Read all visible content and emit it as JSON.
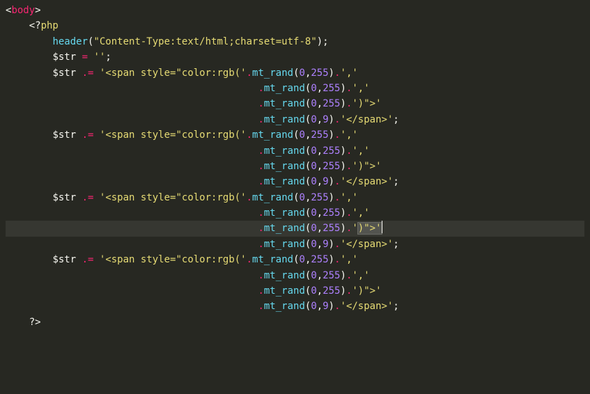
{
  "lines": [
    {
      "segments": [
        {
          "t": "<",
          "c": "tag-angle"
        },
        {
          "t": "body",
          "c": "tag-name"
        },
        {
          "t": ">",
          "c": "tag-angle"
        }
      ]
    },
    {
      "indent": "    ",
      "segments": [
        {
          "t": "<?",
          "c": "punct"
        },
        {
          "t": "php",
          "c": "php-open"
        }
      ]
    },
    {
      "indent": "        ",
      "segments": [
        {
          "t": "header",
          "c": "func"
        },
        {
          "t": "(",
          "c": "punct"
        },
        {
          "t": "\"Content-Type:text/html;charset=utf-8\"",
          "c": "string"
        },
        {
          "t": ");",
          "c": "punct"
        }
      ]
    },
    {
      "indent": "        ",
      "segments": [
        {
          "t": "$str",
          "c": "var"
        },
        {
          "t": " ",
          "c": "punct"
        },
        {
          "t": "=",
          "c": "op"
        },
        {
          "t": " ",
          "c": "punct"
        },
        {
          "t": "''",
          "c": "string"
        },
        {
          "t": ";",
          "c": "punct"
        }
      ]
    },
    {
      "indent": "        ",
      "segments": [
        {
          "t": "$str",
          "c": "var"
        },
        {
          "t": " ",
          "c": "punct"
        },
        {
          "t": ".=",
          "c": "op"
        },
        {
          "t": " ",
          "c": "punct"
        },
        {
          "t": "'<span style=\"color:rgb('",
          "c": "string"
        },
        {
          "t": ".",
          "c": "op"
        },
        {
          "t": "mt_rand",
          "c": "func"
        },
        {
          "t": "(",
          "c": "punct"
        },
        {
          "t": "0",
          "c": "num"
        },
        {
          "t": ",",
          "c": "punct"
        },
        {
          "t": "255",
          "c": "num"
        },
        {
          "t": ")",
          "c": "punct"
        },
        {
          "t": ".",
          "c": "op"
        },
        {
          "t": "','",
          "c": "string"
        }
      ]
    },
    {
      "indent": "                                           ",
      "segments": [
        {
          "t": ".",
          "c": "op"
        },
        {
          "t": "mt_rand",
          "c": "func"
        },
        {
          "t": "(",
          "c": "punct"
        },
        {
          "t": "0",
          "c": "num"
        },
        {
          "t": ",",
          "c": "punct"
        },
        {
          "t": "255",
          "c": "num"
        },
        {
          "t": ")",
          "c": "punct"
        },
        {
          "t": ".",
          "c": "op"
        },
        {
          "t": "','",
          "c": "string"
        }
      ]
    },
    {
      "indent": "                                           ",
      "segments": [
        {
          "t": ".",
          "c": "op"
        },
        {
          "t": "mt_rand",
          "c": "func"
        },
        {
          "t": "(",
          "c": "punct"
        },
        {
          "t": "0",
          "c": "num"
        },
        {
          "t": ",",
          "c": "punct"
        },
        {
          "t": "255",
          "c": "num"
        },
        {
          "t": ")",
          "c": "punct"
        },
        {
          "t": ".",
          "c": "op"
        },
        {
          "t": "')\">'",
          "c": "string"
        }
      ]
    },
    {
      "indent": "                                           ",
      "segments": [
        {
          "t": ".",
          "c": "op"
        },
        {
          "t": "mt_rand",
          "c": "func"
        },
        {
          "t": "(",
          "c": "punct"
        },
        {
          "t": "0",
          "c": "num"
        },
        {
          "t": ",",
          "c": "punct"
        },
        {
          "t": "9",
          "c": "num"
        },
        {
          "t": ")",
          "c": "punct"
        },
        {
          "t": ".",
          "c": "op"
        },
        {
          "t": "'</span>'",
          "c": "string"
        },
        {
          "t": ";",
          "c": "punct"
        }
      ]
    },
    {
      "indent": "        ",
      "segments": [
        {
          "t": "$str",
          "c": "var"
        },
        {
          "t": " ",
          "c": "punct"
        },
        {
          "t": ".=",
          "c": "op"
        },
        {
          "t": " ",
          "c": "punct"
        },
        {
          "t": "'<span style=\"color:rgb('",
          "c": "string"
        },
        {
          "t": ".",
          "c": "op"
        },
        {
          "t": "mt_rand",
          "c": "func"
        },
        {
          "t": "(",
          "c": "punct"
        },
        {
          "t": "0",
          "c": "num"
        },
        {
          "t": ",",
          "c": "punct"
        },
        {
          "t": "255",
          "c": "num"
        },
        {
          "t": ")",
          "c": "punct"
        },
        {
          "t": ".",
          "c": "op"
        },
        {
          "t": "','",
          "c": "string"
        }
      ]
    },
    {
      "indent": "                                           ",
      "segments": [
        {
          "t": ".",
          "c": "op"
        },
        {
          "t": "mt_rand",
          "c": "func"
        },
        {
          "t": "(",
          "c": "punct"
        },
        {
          "t": "0",
          "c": "num"
        },
        {
          "t": ",",
          "c": "punct"
        },
        {
          "t": "255",
          "c": "num"
        },
        {
          "t": ")",
          "c": "punct"
        },
        {
          "t": ".",
          "c": "op"
        },
        {
          "t": "','",
          "c": "string"
        }
      ]
    },
    {
      "indent": "                                           ",
      "segments": [
        {
          "t": ".",
          "c": "op"
        },
        {
          "t": "mt_rand",
          "c": "func"
        },
        {
          "t": "(",
          "c": "punct"
        },
        {
          "t": "0",
          "c": "num"
        },
        {
          "t": ",",
          "c": "punct"
        },
        {
          "t": "255",
          "c": "num"
        },
        {
          "t": ")",
          "c": "punct"
        },
        {
          "t": ".",
          "c": "op"
        },
        {
          "t": "')\">'",
          "c": "string"
        }
      ]
    },
    {
      "indent": "                                           ",
      "segments": [
        {
          "t": ".",
          "c": "op"
        },
        {
          "t": "mt_rand",
          "c": "func"
        },
        {
          "t": "(",
          "c": "punct"
        },
        {
          "t": "0",
          "c": "num"
        },
        {
          "t": ",",
          "c": "punct"
        },
        {
          "t": "9",
          "c": "num"
        },
        {
          "t": ")",
          "c": "punct"
        },
        {
          "t": ".",
          "c": "op"
        },
        {
          "t": "'</span>'",
          "c": "string"
        },
        {
          "t": ";",
          "c": "punct"
        }
      ]
    },
    {
      "indent": "        ",
      "segments": [
        {
          "t": "$str",
          "c": "var"
        },
        {
          "t": " ",
          "c": "punct"
        },
        {
          "t": ".=",
          "c": "op"
        },
        {
          "t": " ",
          "c": "punct"
        },
        {
          "t": "'<span style=\"color:rgb('",
          "c": "string"
        },
        {
          "t": ".",
          "c": "op"
        },
        {
          "t": "mt_rand",
          "c": "func"
        },
        {
          "t": "(",
          "c": "punct"
        },
        {
          "t": "0",
          "c": "num"
        },
        {
          "t": ",",
          "c": "punct"
        },
        {
          "t": "255",
          "c": "num"
        },
        {
          "t": ")",
          "c": "punct"
        },
        {
          "t": ".",
          "c": "op"
        },
        {
          "t": "','",
          "c": "string"
        }
      ]
    },
    {
      "indent": "                                           ",
      "segments": [
        {
          "t": ".",
          "c": "op"
        },
        {
          "t": "mt_rand",
          "c": "func"
        },
        {
          "t": "(",
          "c": "punct"
        },
        {
          "t": "0",
          "c": "num"
        },
        {
          "t": ",",
          "c": "punct"
        },
        {
          "t": "255",
          "c": "num"
        },
        {
          "t": ")",
          "c": "punct"
        },
        {
          "t": ".",
          "c": "op"
        },
        {
          "t": "','",
          "c": "string"
        }
      ]
    },
    {
      "indent": "                                           ",
      "segments": [
        {
          "t": ".",
          "c": "op"
        },
        {
          "t": "mt_rand",
          "c": "func"
        },
        {
          "t": "(",
          "c": "punct"
        },
        {
          "t": "0",
          "c": "num"
        },
        {
          "t": ",",
          "c": "punct"
        },
        {
          "t": "255",
          "c": "num"
        },
        {
          "t": ")",
          "c": "punct"
        },
        {
          "t": ".",
          "c": "op"
        },
        {
          "t": "'",
          "c": "string"
        },
        {
          "t": ")\">'",
          "c": "string cursor-sel"
        }
      ],
      "highlight": true,
      "cursor": true
    },
    {
      "indent": "                                           ",
      "segments": [
        {
          "t": ".",
          "c": "op"
        },
        {
          "t": "mt_rand",
          "c": "func"
        },
        {
          "t": "(",
          "c": "punct"
        },
        {
          "t": "0",
          "c": "num"
        },
        {
          "t": ",",
          "c": "punct"
        },
        {
          "t": "9",
          "c": "num"
        },
        {
          "t": ")",
          "c": "punct"
        },
        {
          "t": ".",
          "c": "op"
        },
        {
          "t": "'</span>'",
          "c": "string"
        },
        {
          "t": ";",
          "c": "punct"
        }
      ]
    },
    {
      "indent": "        ",
      "segments": [
        {
          "t": "$str",
          "c": "var"
        },
        {
          "t": " ",
          "c": "punct"
        },
        {
          "t": ".=",
          "c": "op"
        },
        {
          "t": " ",
          "c": "punct"
        },
        {
          "t": "'<span style=\"color:rgb('",
          "c": "string"
        },
        {
          "t": ".",
          "c": "op"
        },
        {
          "t": "mt_rand",
          "c": "func"
        },
        {
          "t": "(",
          "c": "punct"
        },
        {
          "t": "0",
          "c": "num"
        },
        {
          "t": ",",
          "c": "punct"
        },
        {
          "t": "255",
          "c": "num"
        },
        {
          "t": ")",
          "c": "punct"
        },
        {
          "t": ".",
          "c": "op"
        },
        {
          "t": "','",
          "c": "string"
        }
      ]
    },
    {
      "indent": "                                           ",
      "segments": [
        {
          "t": ".",
          "c": "op"
        },
        {
          "t": "mt_rand",
          "c": "func"
        },
        {
          "t": "(",
          "c": "punct"
        },
        {
          "t": "0",
          "c": "num"
        },
        {
          "t": ",",
          "c": "punct"
        },
        {
          "t": "255",
          "c": "num"
        },
        {
          "t": ")",
          "c": "punct"
        },
        {
          "t": ".",
          "c": "op"
        },
        {
          "t": "','",
          "c": "string"
        }
      ]
    },
    {
      "indent": "                                           ",
      "segments": [
        {
          "t": ".",
          "c": "op"
        },
        {
          "t": "mt_rand",
          "c": "func"
        },
        {
          "t": "(",
          "c": "punct"
        },
        {
          "t": "0",
          "c": "num"
        },
        {
          "t": ",",
          "c": "punct"
        },
        {
          "t": "255",
          "c": "num"
        },
        {
          "t": ")",
          "c": "punct"
        },
        {
          "t": ".",
          "c": "op"
        },
        {
          "t": "')\">'",
          "c": "string"
        }
      ]
    },
    {
      "indent": "                                           ",
      "segments": [
        {
          "t": ".",
          "c": "op"
        },
        {
          "t": "mt_rand",
          "c": "func"
        },
        {
          "t": "(",
          "c": "punct"
        },
        {
          "t": "0",
          "c": "num"
        },
        {
          "t": ",",
          "c": "punct"
        },
        {
          "t": "9",
          "c": "num"
        },
        {
          "t": ")",
          "c": "punct"
        },
        {
          "t": ".",
          "c": "op"
        },
        {
          "t": "'</span>'",
          "c": "string"
        },
        {
          "t": ";",
          "c": "punct"
        }
      ]
    },
    {
      "indent": "    ",
      "segments": [
        {
          "t": "?>",
          "c": "punct"
        }
      ]
    }
  ]
}
